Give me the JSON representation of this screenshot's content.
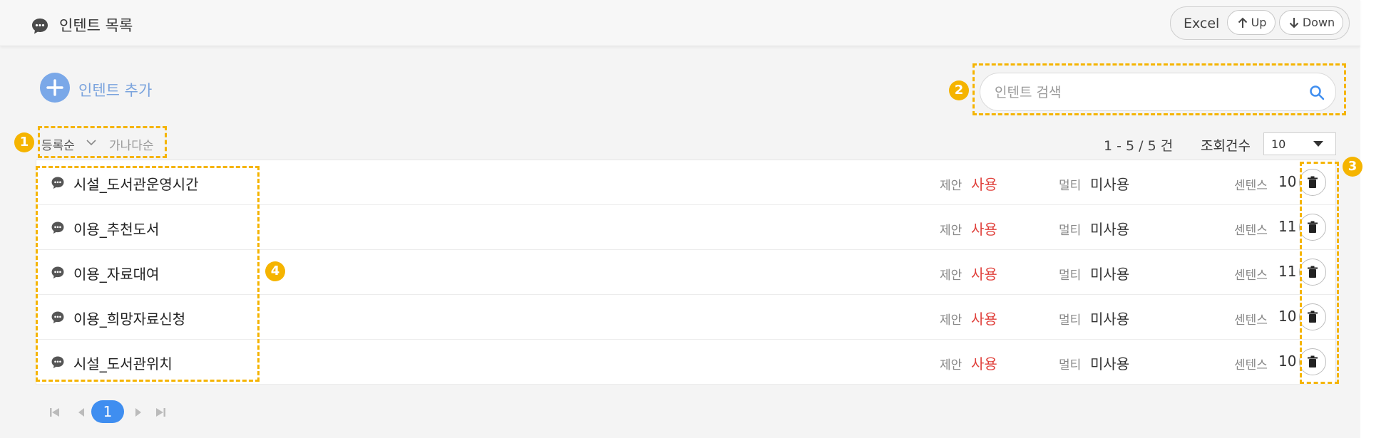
{
  "header": {
    "title": "인텐트 목록",
    "excel_label": "Excel",
    "up_label": "Up",
    "down_label": "Down"
  },
  "add": {
    "label": "인텐트 추가"
  },
  "search": {
    "placeholder": "인텐트 검색",
    "value": ""
  },
  "sort": {
    "registered": "등록순",
    "alphabetical": "가나다순"
  },
  "paging": {
    "info": "1 - 5 / 5 건",
    "page_size_label": "조회건수",
    "page_size": "10",
    "current_page": "1"
  },
  "labels": {
    "proposal": "제안",
    "multi": "멀티",
    "sentence": "센텐스"
  },
  "intents": [
    {
      "name": "시설_도서관운영시간",
      "proposal": "사용",
      "multi": "미사용",
      "sentences": "10"
    },
    {
      "name": "이용_추천도서",
      "proposal": "사용",
      "multi": "미사용",
      "sentences": "11"
    },
    {
      "name": "이용_자료대여",
      "proposal": "사용",
      "multi": "미사용",
      "sentences": "11"
    },
    {
      "name": "이용_희망자료신청",
      "proposal": "사용",
      "multi": "미사용",
      "sentences": "10"
    },
    {
      "name": "시설_도서관위치",
      "proposal": "사용",
      "multi": "미사용",
      "sentences": "10"
    }
  ],
  "annotations": [
    "1",
    "2",
    "3",
    "4"
  ],
  "colors": {
    "accent": "#3f8ef0",
    "add_button": "#7aa8e8",
    "status_active": "#e0413c",
    "annotation": "#f5b400"
  },
  "icons": {
    "header": "chat-bubble-icon",
    "add": "plus-icon",
    "search": "search-icon",
    "row": "chat-bubble-icon",
    "delete": "trash-icon"
  }
}
